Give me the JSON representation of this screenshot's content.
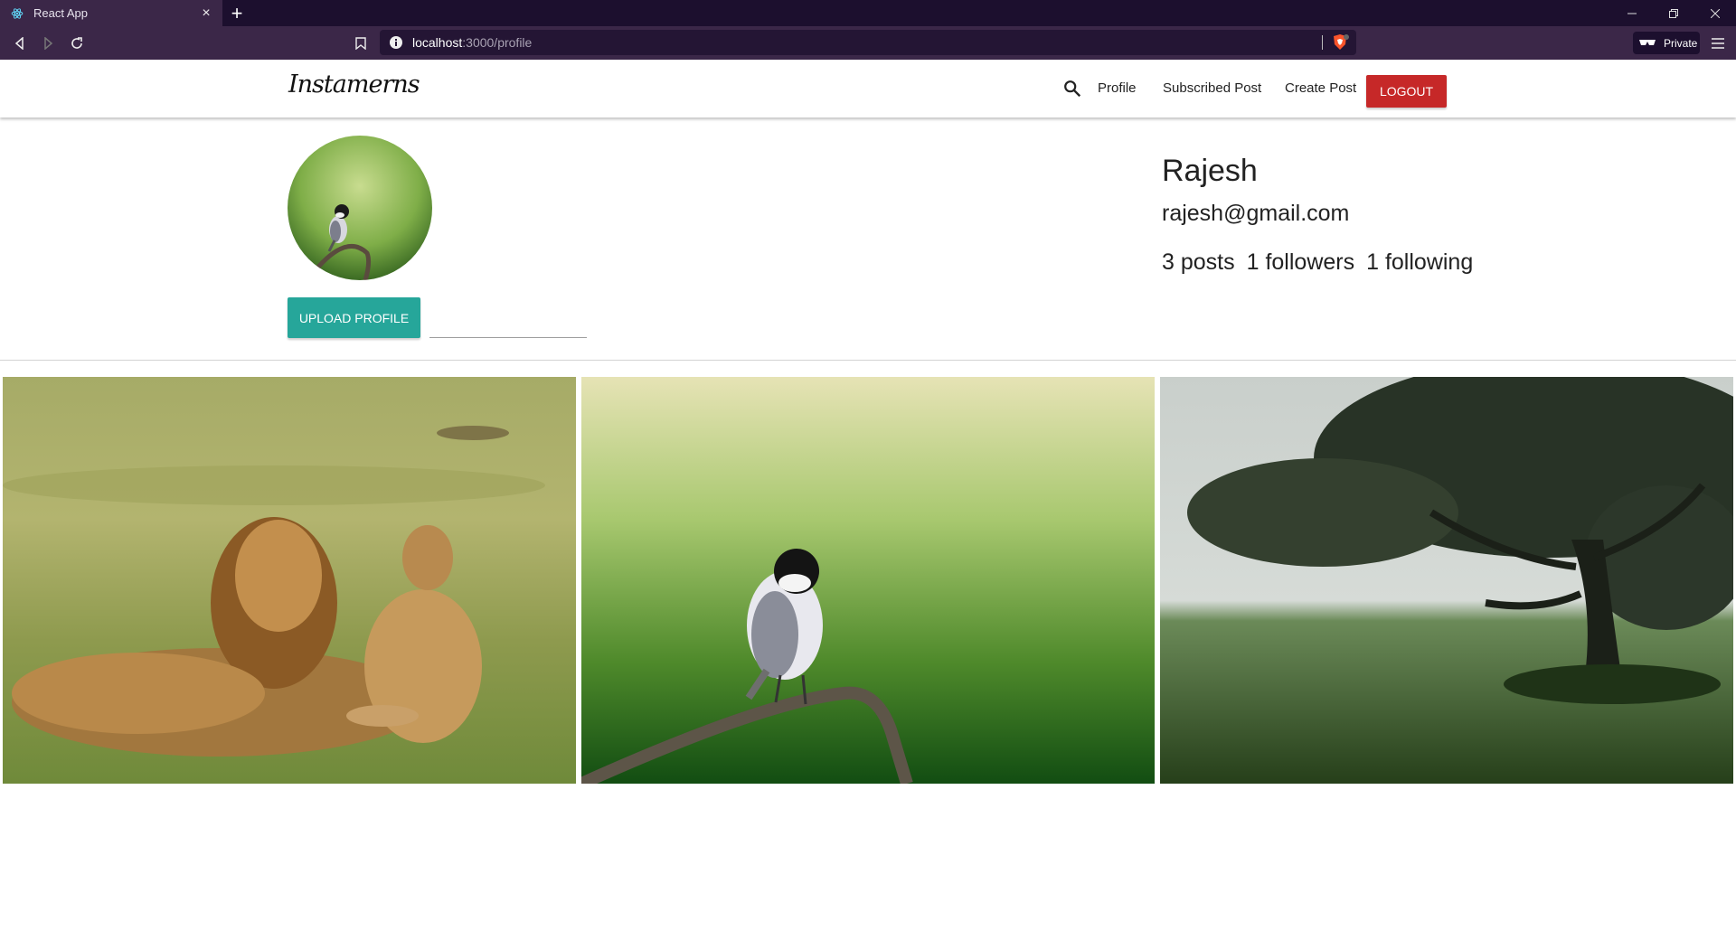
{
  "browser": {
    "tab_title": "React App",
    "url_host": "localhost",
    "url_path": ":3000/profile",
    "private_label": "Private"
  },
  "app": {
    "brand": "Instamerns",
    "nav": {
      "profile": "Profile",
      "subscribed": "Subscribed Post",
      "create": "Create Post",
      "logout": "LOGOUT"
    }
  },
  "profile": {
    "username": "Rajesh",
    "email": "rajesh@gmail.com",
    "posts": "3 posts",
    "followers": "1 followers",
    "following": "1 following",
    "upload_label": "UPLOAD PROFILE",
    "file_path_value": ""
  },
  "gallery": {
    "photos": [
      {
        "subject": "lions"
      },
      {
        "subject": "bird"
      },
      {
        "subject": "tree"
      }
    ]
  },
  "colors": {
    "logout": "#c62828",
    "upload": "#26a69a",
    "chrome_bg": "#1c0f2e",
    "toolbar_bg": "#3b2748"
  }
}
